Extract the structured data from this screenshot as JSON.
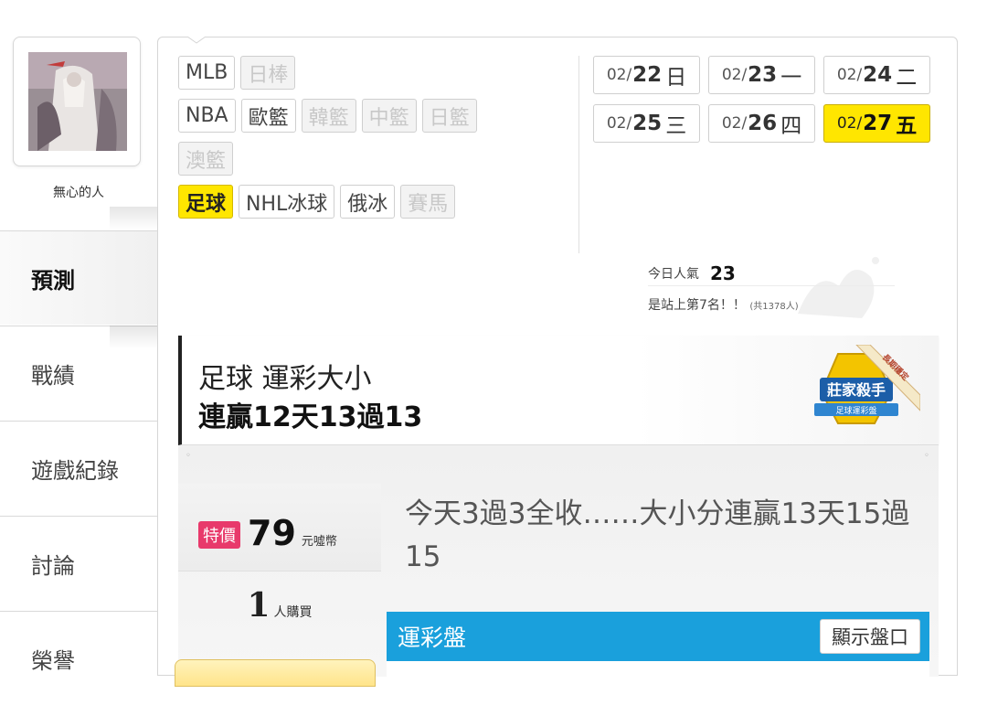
{
  "user": {
    "name": "無心的人"
  },
  "sidebar": {
    "items": [
      {
        "label": "預測",
        "active": true
      },
      {
        "label": "戰績",
        "active": false
      },
      {
        "label": "遊戲紀錄",
        "active": false
      },
      {
        "label": "討論",
        "active": false
      },
      {
        "label": "榮譽",
        "active": false
      }
    ]
  },
  "categories": {
    "row1": [
      {
        "label": "MLB",
        "state": "normal"
      },
      {
        "label": "日棒",
        "state": "off"
      }
    ],
    "row2": [
      {
        "label": "NBA",
        "state": "normal"
      },
      {
        "label": "歐籃",
        "state": "normal"
      },
      {
        "label": "韓籃",
        "state": "off"
      },
      {
        "label": "中籃",
        "state": "off"
      },
      {
        "label": "日籃",
        "state": "off"
      }
    ],
    "row3": [
      {
        "label": "澳籃",
        "state": "off"
      }
    ],
    "row4": [
      {
        "label": "足球",
        "state": "on"
      },
      {
        "label": "NHL冰球",
        "state": "normal"
      },
      {
        "label": "俄冰",
        "state": "normal"
      },
      {
        "label": "賽馬",
        "state": "off"
      }
    ]
  },
  "dates": [
    {
      "md": "02/",
      "day": "22",
      "weekday": "日",
      "active": false
    },
    {
      "md": "02/",
      "day": "23",
      "weekday": "一",
      "active": false
    },
    {
      "md": "02/",
      "day": "24",
      "weekday": "二",
      "active": false
    },
    {
      "md": "02/",
      "day": "25",
      "weekday": "三",
      "active": false
    },
    {
      "md": "02/",
      "day": "26",
      "weekday": "四",
      "active": false
    },
    {
      "md": "02/",
      "day": "27",
      "weekday": "五",
      "active": true
    }
  ],
  "popularity": {
    "label": "今日人氣",
    "count": "23",
    "rank_text": "是站上第7名！！",
    "total_text": "(共1378人)"
  },
  "headline": {
    "line1": "足球 運彩大小",
    "line2": "連贏12天13過13",
    "badge_title": "莊家殺手",
    "badge_sub": "足球運彩盤",
    "badge_ribbon": "長期穩定"
  },
  "offer": {
    "special_label": "特價",
    "price": "79",
    "unit": "元噓幣",
    "buyers_count": "1",
    "buyers_label": "人購買",
    "description": "今天3過3全收……大小分連贏13天15過15"
  },
  "bar": {
    "title": "運彩盤",
    "button": "顯示盤口",
    "color": "#1aa0dc"
  },
  "colors": {
    "highlight": "#ffe600",
    "special": "#e8396b"
  }
}
